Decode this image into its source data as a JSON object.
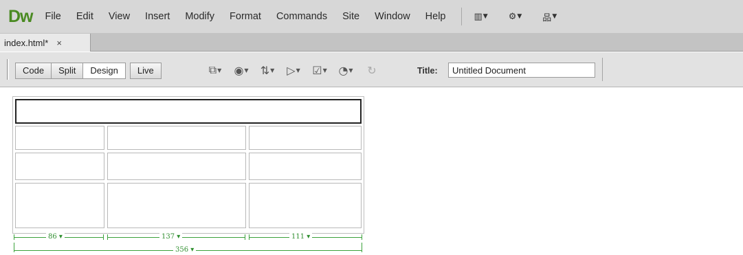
{
  "app": {
    "logo_text": "Dw",
    "accent_color": "#4a8a22"
  },
  "menubar": {
    "items": [
      "File",
      "Edit",
      "View",
      "Insert",
      "Modify",
      "Format",
      "Commands",
      "Site",
      "Window",
      "Help"
    ],
    "tools": [
      {
        "icon": "layout-icon",
        "glyph": "▥"
      },
      {
        "icon": "gear-icon",
        "glyph": "⚙"
      },
      {
        "icon": "site-icon",
        "glyph": "品"
      }
    ]
  },
  "tabbar": {
    "tab_label": "index.html*",
    "close_glyph": "×"
  },
  "doc_toolbar": {
    "views": [
      "Code",
      "Split",
      "Design",
      "Live"
    ],
    "active_view": "Design",
    "icons": [
      {
        "icon": "multiscreen-icon",
        "glyph": "⧉"
      },
      {
        "icon": "preview-browser-icon",
        "glyph": "◉"
      },
      {
        "icon": "file-management-icon",
        "glyph": "⇅"
      },
      {
        "icon": "visual-aids-icon",
        "glyph": "▷"
      },
      {
        "icon": "validate-icon",
        "glyph": "☑"
      },
      {
        "icon": "browser-compat-icon",
        "glyph": "◔"
      },
      {
        "icon": "refresh-icon",
        "glyph": "↻"
      }
    ],
    "title_label": "Title:",
    "title_value": "Untitled Document"
  },
  "table": {
    "rows": 4,
    "column_widths": [
      "86",
      "137",
      "111"
    ],
    "total_width": "356",
    "line_color": "#3aa13a"
  }
}
